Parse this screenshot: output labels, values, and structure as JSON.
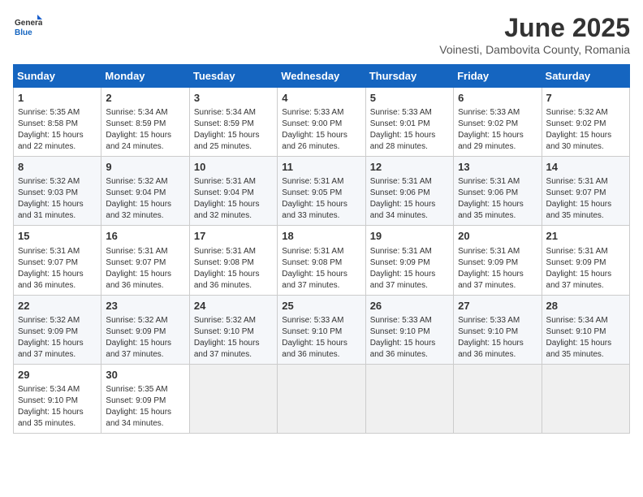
{
  "header": {
    "logo_general": "General",
    "logo_blue": "Blue",
    "title": "June 2025",
    "subtitle": "Voinesti, Dambovita County, Romania"
  },
  "weekdays": [
    "Sunday",
    "Monday",
    "Tuesday",
    "Wednesday",
    "Thursday",
    "Friday",
    "Saturday"
  ],
  "weeks": [
    [
      {
        "day": "1",
        "content": "Sunrise: 5:35 AM\nSunset: 8:58 PM\nDaylight: 15 hours\nand 22 minutes."
      },
      {
        "day": "2",
        "content": "Sunrise: 5:34 AM\nSunset: 8:59 PM\nDaylight: 15 hours\nand 24 minutes."
      },
      {
        "day": "3",
        "content": "Sunrise: 5:34 AM\nSunset: 8:59 PM\nDaylight: 15 hours\nand 25 minutes."
      },
      {
        "day": "4",
        "content": "Sunrise: 5:33 AM\nSunset: 9:00 PM\nDaylight: 15 hours\nand 26 minutes."
      },
      {
        "day": "5",
        "content": "Sunrise: 5:33 AM\nSunset: 9:01 PM\nDaylight: 15 hours\nand 28 minutes."
      },
      {
        "day": "6",
        "content": "Sunrise: 5:33 AM\nSunset: 9:02 PM\nDaylight: 15 hours\nand 29 minutes."
      },
      {
        "day": "7",
        "content": "Sunrise: 5:32 AM\nSunset: 9:02 PM\nDaylight: 15 hours\nand 30 minutes."
      }
    ],
    [
      {
        "day": "8",
        "content": "Sunrise: 5:32 AM\nSunset: 9:03 PM\nDaylight: 15 hours\nand 31 minutes."
      },
      {
        "day": "9",
        "content": "Sunrise: 5:32 AM\nSunset: 9:04 PM\nDaylight: 15 hours\nand 32 minutes."
      },
      {
        "day": "10",
        "content": "Sunrise: 5:31 AM\nSunset: 9:04 PM\nDaylight: 15 hours\nand 32 minutes."
      },
      {
        "day": "11",
        "content": "Sunrise: 5:31 AM\nSunset: 9:05 PM\nDaylight: 15 hours\nand 33 minutes."
      },
      {
        "day": "12",
        "content": "Sunrise: 5:31 AM\nSunset: 9:06 PM\nDaylight: 15 hours\nand 34 minutes."
      },
      {
        "day": "13",
        "content": "Sunrise: 5:31 AM\nSunset: 9:06 PM\nDaylight: 15 hours\nand 35 minutes."
      },
      {
        "day": "14",
        "content": "Sunrise: 5:31 AM\nSunset: 9:07 PM\nDaylight: 15 hours\nand 35 minutes."
      }
    ],
    [
      {
        "day": "15",
        "content": "Sunrise: 5:31 AM\nSunset: 9:07 PM\nDaylight: 15 hours\nand 36 minutes."
      },
      {
        "day": "16",
        "content": "Sunrise: 5:31 AM\nSunset: 9:07 PM\nDaylight: 15 hours\nand 36 minutes."
      },
      {
        "day": "17",
        "content": "Sunrise: 5:31 AM\nSunset: 9:08 PM\nDaylight: 15 hours\nand 36 minutes."
      },
      {
        "day": "18",
        "content": "Sunrise: 5:31 AM\nSunset: 9:08 PM\nDaylight: 15 hours\nand 37 minutes."
      },
      {
        "day": "19",
        "content": "Sunrise: 5:31 AM\nSunset: 9:09 PM\nDaylight: 15 hours\nand 37 minutes."
      },
      {
        "day": "20",
        "content": "Sunrise: 5:31 AM\nSunset: 9:09 PM\nDaylight: 15 hours\nand 37 minutes."
      },
      {
        "day": "21",
        "content": "Sunrise: 5:31 AM\nSunset: 9:09 PM\nDaylight: 15 hours\nand 37 minutes."
      }
    ],
    [
      {
        "day": "22",
        "content": "Sunrise: 5:32 AM\nSunset: 9:09 PM\nDaylight: 15 hours\nand 37 minutes."
      },
      {
        "day": "23",
        "content": "Sunrise: 5:32 AM\nSunset: 9:09 PM\nDaylight: 15 hours\nand 37 minutes."
      },
      {
        "day": "24",
        "content": "Sunrise: 5:32 AM\nSunset: 9:10 PM\nDaylight: 15 hours\nand 37 minutes."
      },
      {
        "day": "25",
        "content": "Sunrise: 5:33 AM\nSunset: 9:10 PM\nDaylight: 15 hours\nand 36 minutes."
      },
      {
        "day": "26",
        "content": "Sunrise: 5:33 AM\nSunset: 9:10 PM\nDaylight: 15 hours\nand 36 minutes."
      },
      {
        "day": "27",
        "content": "Sunrise: 5:33 AM\nSunset: 9:10 PM\nDaylight: 15 hours\nand 36 minutes."
      },
      {
        "day": "28",
        "content": "Sunrise: 5:34 AM\nSunset: 9:10 PM\nDaylight: 15 hours\nand 35 minutes."
      }
    ],
    [
      {
        "day": "29",
        "content": "Sunrise: 5:34 AM\nSunset: 9:10 PM\nDaylight: 15 hours\nand 35 minutes."
      },
      {
        "day": "30",
        "content": "Sunrise: 5:35 AM\nSunset: 9:09 PM\nDaylight: 15 hours\nand 34 minutes."
      },
      {
        "day": "",
        "content": ""
      },
      {
        "day": "",
        "content": ""
      },
      {
        "day": "",
        "content": ""
      },
      {
        "day": "",
        "content": ""
      },
      {
        "day": "",
        "content": ""
      }
    ]
  ]
}
